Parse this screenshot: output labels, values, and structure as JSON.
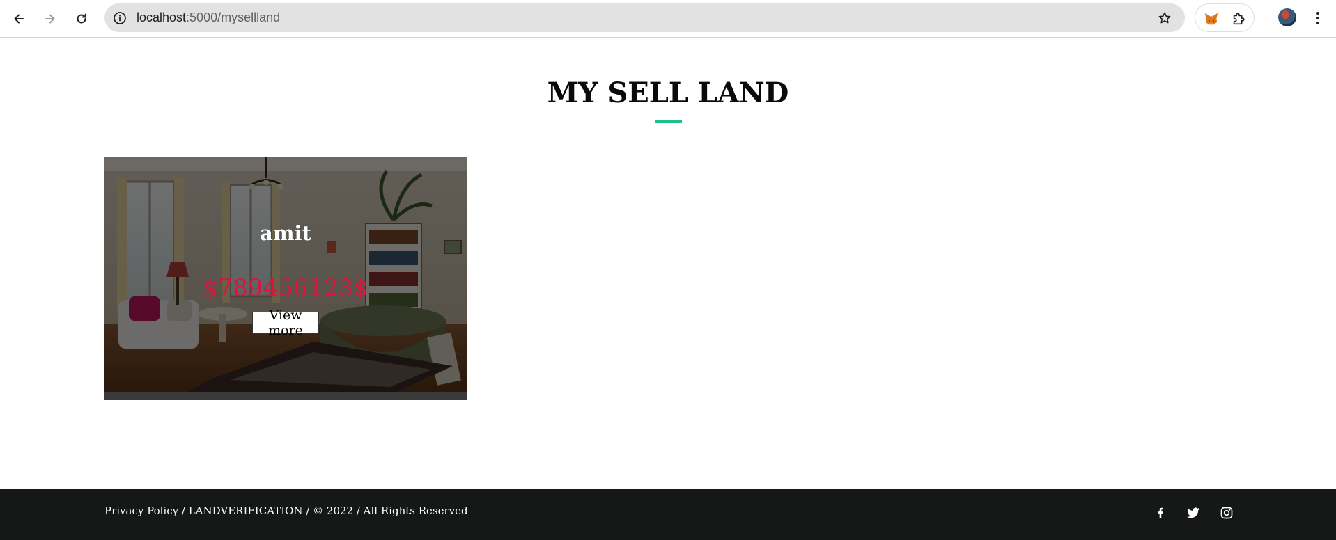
{
  "browser": {
    "url_host": "localhost",
    "url_rest": ":5000/mysellland"
  },
  "page": {
    "title": "MY SELL LAND",
    "accent_color": "#1ec08f"
  },
  "listings": [
    {
      "name": "amit",
      "price": "$789456123$",
      "button_label": "View more"
    }
  ],
  "footer": {
    "text": "Privacy Policy / LANDVERIFICATION / © 2022 / All Rights Reserved",
    "social_icons": [
      "facebook-icon",
      "twitter-icon",
      "instagram-icon"
    ]
  }
}
